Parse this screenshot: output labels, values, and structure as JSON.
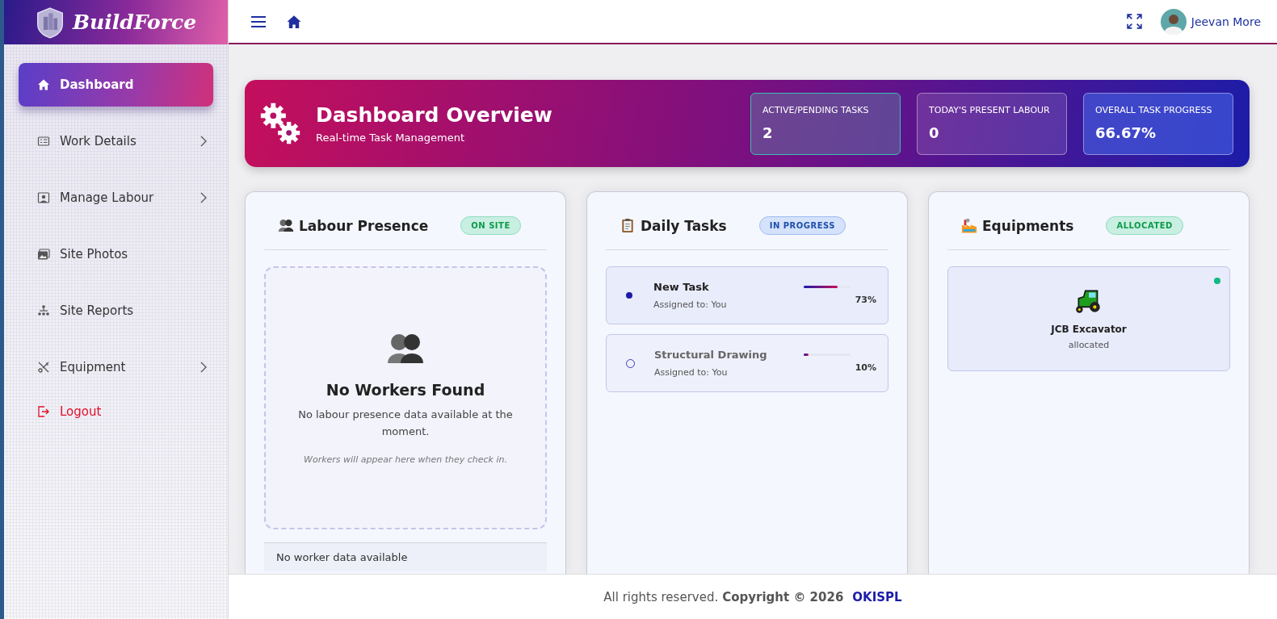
{
  "brand": {
    "name": "BuildForce"
  },
  "sidebar": {
    "items": [
      {
        "label": "Dashboard",
        "selected": true,
        "has_submenu": false,
        "kind": "link"
      },
      {
        "label": "Work Details",
        "selected": false,
        "has_submenu": true,
        "kind": "link"
      },
      {
        "label": "Manage Labour",
        "selected": false,
        "has_submenu": true,
        "kind": "link"
      },
      {
        "label": "Site Photos",
        "selected": false,
        "has_submenu": false,
        "kind": "link"
      },
      {
        "label": "Site Reports",
        "selected": false,
        "has_submenu": false,
        "kind": "link"
      },
      {
        "label": "Equipment",
        "selected": false,
        "has_submenu": true,
        "kind": "link"
      },
      {
        "label": "Logout",
        "selected": false,
        "has_submenu": false,
        "kind": "logout"
      }
    ]
  },
  "topbar": {
    "user": "Jeevan More"
  },
  "overview": {
    "title": "Dashboard Overview",
    "subtitle": "Real-time Task Management",
    "stats": [
      {
        "label": "ACTIVE/PENDING TASKS",
        "value": "2"
      },
      {
        "label": "TODAY'S PRESENT LABOUR",
        "value": "0"
      },
      {
        "label": "OVERALL TASK PROGRESS",
        "value": "66.67%"
      }
    ]
  },
  "labour": {
    "title": "Labour Presence",
    "badge": "ON SITE",
    "empty_title": "No Workers Found",
    "empty_text": "No labour presence data available at the moment.",
    "empty_hint": "Workers will appear here when they check in.",
    "footer_note": "No worker data available"
  },
  "tasks": {
    "title": "Daily Tasks",
    "badge": "IN PROGRESS",
    "items": [
      {
        "title": "New Task",
        "assignee": "Assigned to: You",
        "active": true,
        "level": 0.73,
        "percent": "73%"
      },
      {
        "title": "Structural Drawing",
        "assignee": "Assigned to: You",
        "active": false,
        "level": 0.1,
        "percent": "10%"
      }
    ]
  },
  "equipment": {
    "title": "Equipments",
    "badge": "ALLOCATED",
    "items": [
      {
        "name": "JCB Excavator",
        "status": "allocated",
        "color": "#10b981"
      }
    ]
  },
  "footer": {
    "text": "All rights reserved.",
    "copyright": "Copyright © 2026",
    "company": "OKISPL"
  }
}
